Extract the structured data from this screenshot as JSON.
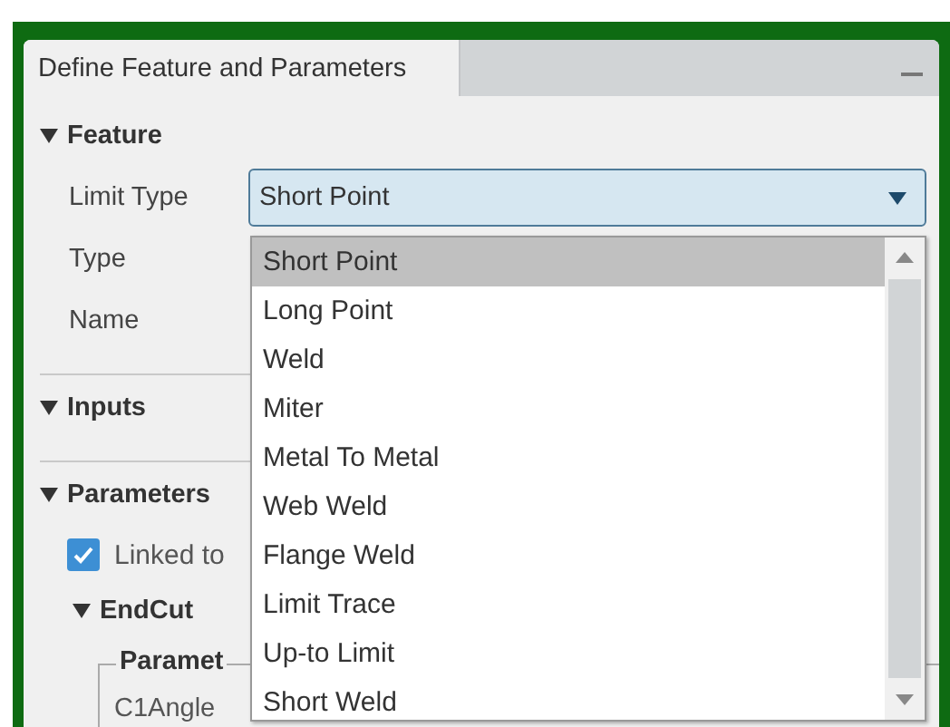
{
  "panel": {
    "title": "Define Feature and Parameters"
  },
  "feature": {
    "title": "Feature",
    "expanded": true,
    "fields": [
      {
        "label": "Limit Type",
        "kind": "combo",
        "value": "Short Point"
      },
      {
        "label": "Type",
        "kind": "plain"
      },
      {
        "label": "Name",
        "kind": "plain"
      }
    ]
  },
  "inputs": {
    "title": "Inputs",
    "expanded": true
  },
  "parameters": {
    "title": "Parameters",
    "expanded": true,
    "checkbox": {
      "label": "Linked to",
      "checked": true
    },
    "endcut": {
      "title": "EndCut",
      "expanded": true,
      "group": {
        "title": "Paramet",
        "fields": [
          {
            "label": "C1Angle"
          }
        ]
      }
    }
  },
  "dropdown": {
    "items": [
      {
        "label": "Short Point",
        "selected": true
      },
      {
        "label": "Long Point",
        "selected": false
      },
      {
        "label": "Weld",
        "selected": false
      },
      {
        "label": "Miter",
        "selected": false
      },
      {
        "label": "Metal To Metal",
        "selected": false
      },
      {
        "label": "Web Weld",
        "selected": false
      },
      {
        "label": "Flange Weld",
        "selected": false
      },
      {
        "label": "Limit Trace",
        "selected": false
      },
      {
        "label": "Up-to Limit",
        "selected": false
      },
      {
        "label": "Short Weld",
        "selected": false
      }
    ]
  }
}
